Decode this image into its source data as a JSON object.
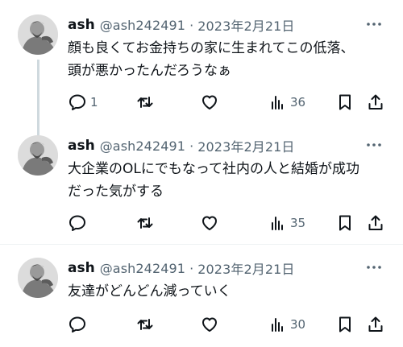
{
  "tweets": [
    {
      "name": "ash",
      "handle": "@ash242491",
      "separator": "·",
      "date": "2023年2月21日",
      "text_lines": [
        "顔も良くてお金持ちの家に生まれてこの低落、",
        "頭が悪かったんだろうなぁ"
      ],
      "reply_count": "1",
      "retweet_count": "",
      "like_count": "",
      "view_count": "36"
    },
    {
      "name": "ash",
      "handle": "@ash242491",
      "separator": "·",
      "date": "2023年2月21日",
      "text_lines": [
        "大企業のOLにでもなって社内の人と結婚が成功",
        "だった気がする"
      ],
      "reply_count": "",
      "retweet_count": "",
      "like_count": "",
      "view_count": "35"
    },
    {
      "name": "ash",
      "handle": "@ash242491",
      "separator": "·",
      "date": "2023年2月21日",
      "text_lines": [
        "友達がどんどん減っていく"
      ],
      "reply_count": "",
      "retweet_count": "",
      "like_count": "",
      "view_count": "30"
    }
  ],
  "icons": {
    "more": "more-horizontal-icon",
    "reply": "reply-bubble-icon",
    "retweet": "retweet-arrows-icon",
    "like": "heart-icon",
    "views": "bar-chart-icon",
    "bookmark": "bookmark-icon",
    "share": "share-upload-icon"
  },
  "colors": {
    "text": "#0f1419",
    "secondary": "#536471",
    "thread_line": "#cfd9de",
    "divider": "#eff3f4"
  }
}
